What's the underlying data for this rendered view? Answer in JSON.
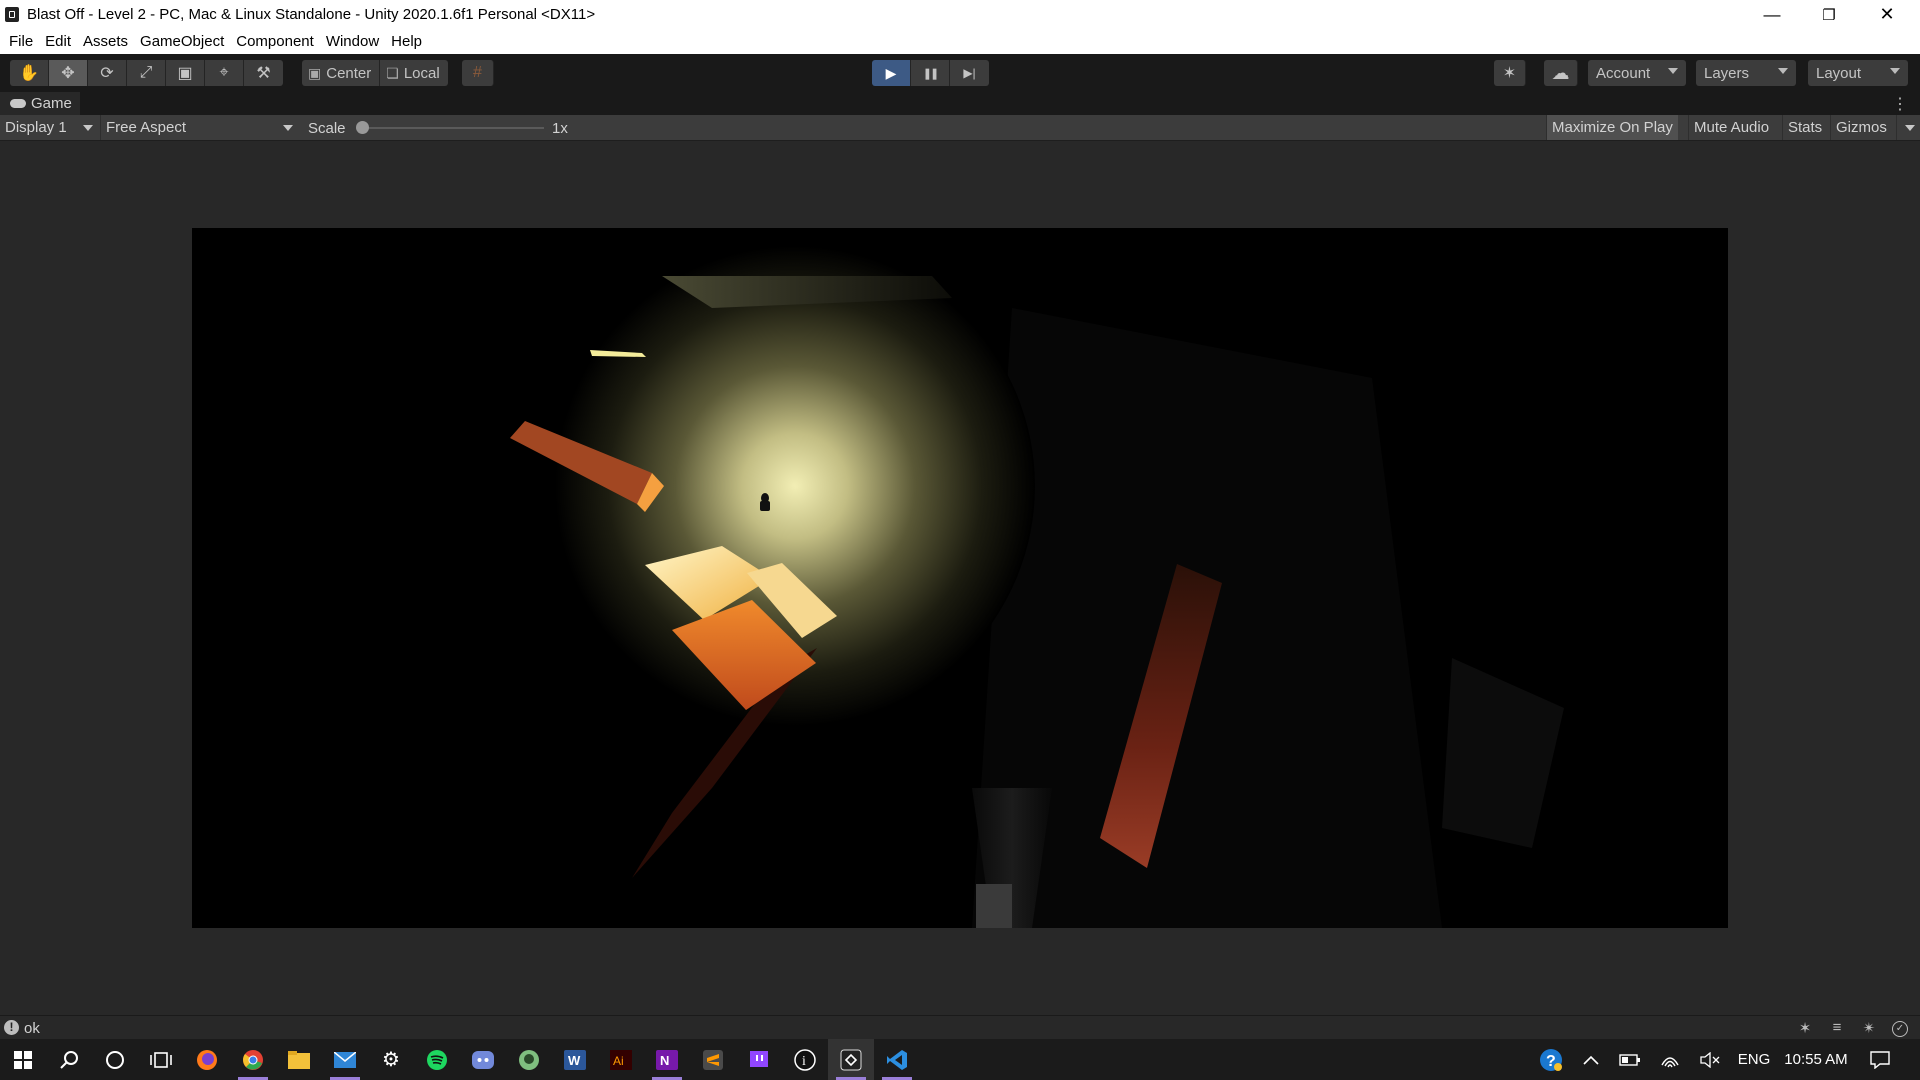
{
  "window": {
    "title": "Blast Off - Level 2 - PC, Mac & Linux Standalone - Unity 2020.1.6f1 Personal <DX11>",
    "controls": {
      "minimize": "—",
      "restore": "❐",
      "close": "✕"
    }
  },
  "menu": [
    "File",
    "Edit",
    "Assets",
    "GameObject",
    "Component",
    "Window",
    "Help"
  ],
  "toolbar": {
    "tools": [
      {
        "name": "hand-tool",
        "glyph": "✋"
      },
      {
        "name": "move-tool",
        "glyph": "✥"
      },
      {
        "name": "rotate-tool",
        "glyph": "⟳"
      },
      {
        "name": "scale-tool",
        "glyph": "⤢"
      },
      {
        "name": "rect-tool",
        "glyph": "▣"
      },
      {
        "name": "transform-tool",
        "glyph": "⌖"
      },
      {
        "name": "custom-tool",
        "glyph": "⚒"
      }
    ],
    "pivot_label": "Center",
    "rotation_label": "Local",
    "grid_glyph": "#",
    "play_glyph": "▶",
    "pause_glyph": "❚❚",
    "step_glyph": "▶|",
    "services_glyph": "✶",
    "cloud_glyph": "☁",
    "account_label": "Account",
    "layers_label": "Layers",
    "layout_label": "Layout"
  },
  "game_tab": {
    "label": "Game",
    "more_glyph": "⋮"
  },
  "game_toolbar": {
    "display": "Display 1",
    "aspect": "Free Aspect",
    "scale_label": "Scale",
    "scale_value": "1x",
    "scale_level": 0.0,
    "maximize_on_play": "Maximize On Play",
    "mute_audio": "Mute Audio",
    "stats": "Stats",
    "gizmos": "Gizmos"
  },
  "status": {
    "icon": "!",
    "message": "ok"
  },
  "status_icons": [
    "✶",
    "≡",
    "✴",
    "✓"
  ],
  "taskbar": {
    "apps": [
      "windows-start",
      "search",
      "cortana",
      "task-view",
      "firefox",
      "chrome",
      "file-explorer",
      "mail",
      "settings",
      "spotify",
      "discord",
      "android-app",
      "word",
      "illustrator",
      "onenote",
      "sublime-text",
      "twitch",
      "app-i",
      "unity",
      "vscode"
    ],
    "language": "ENG",
    "time": "10:55 AM"
  },
  "colors": {
    "editor_bg": "#282828",
    "toolbar_bg": "#191919",
    "accent_play": "#3d5a85",
    "scene_light": "#f4f0b8",
    "block_orange": "#e07030"
  }
}
